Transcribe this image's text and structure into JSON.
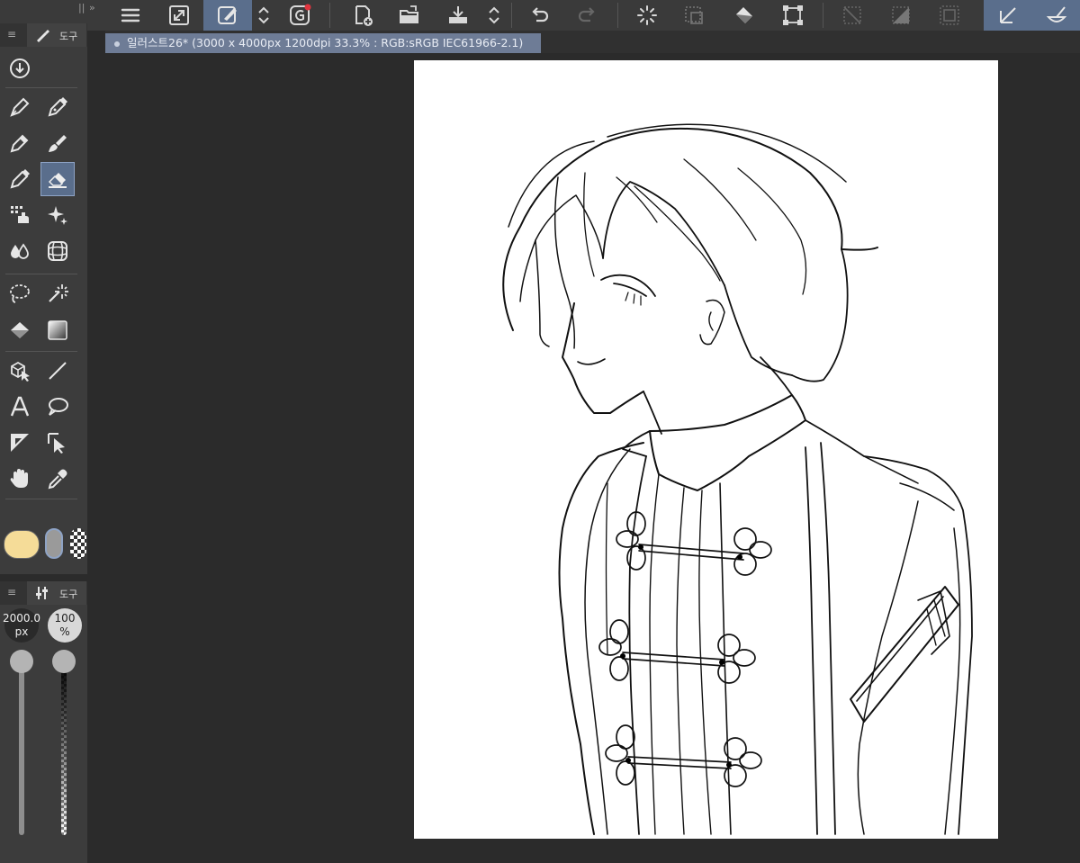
{
  "document_tab": {
    "title": "일러스트26* (3000 x 4000px 1200dpi 33.3% : RGB:sRGB IEC61966-2.1)"
  },
  "tool_panel": {
    "tab_label": "도구"
  },
  "brush_panel": {
    "tab_label": "도구",
    "size_value": "2000.0",
    "size_unit": "px",
    "opacity_value": "100",
    "opacity_unit": "%",
    "size_level_fraction": 1.0,
    "opacity_level_fraction": 1.0
  },
  "colors": {
    "main_color": "#f5dc98",
    "active_highlight": "#5a6e8c",
    "canvas_background": "#ffffff",
    "workspace_background": "#2b2b2b"
  },
  "toolbar_icons": [
    "menu-icon",
    "canvas-size-icon",
    "brush-correction-icon",
    "chevron-updown-icon",
    "brand-icon",
    "new-file-icon",
    "open-file-icon",
    "save-file-icon",
    "chevron-updown-icon",
    "undo-icon",
    "redo-icon",
    "loading-icon",
    "deselect-icon",
    "fill-icon",
    "transform-icon",
    "clear-selection-icon",
    "invert-selection-icon",
    "selection-border-icon",
    "ruler-snap-icon",
    "eraser-snap-icon"
  ],
  "tool_icons": [
    "download-icon",
    "pen-icon",
    "pencil-icon",
    "marker-icon",
    "brush-icon",
    "airbrush-icon",
    "eraser-icon",
    "decoration-icon",
    "sparkle-icon",
    "blend-icon",
    "grid-icon",
    "lasso-icon",
    "magic-wand-icon",
    "fill-icon",
    "gradient-icon",
    "3d-object-icon",
    "line-icon",
    "text-icon",
    "speech-balloon-icon",
    "frame-icon",
    "object-select-icon",
    "hand-icon",
    "eyedropper-icon"
  ]
}
